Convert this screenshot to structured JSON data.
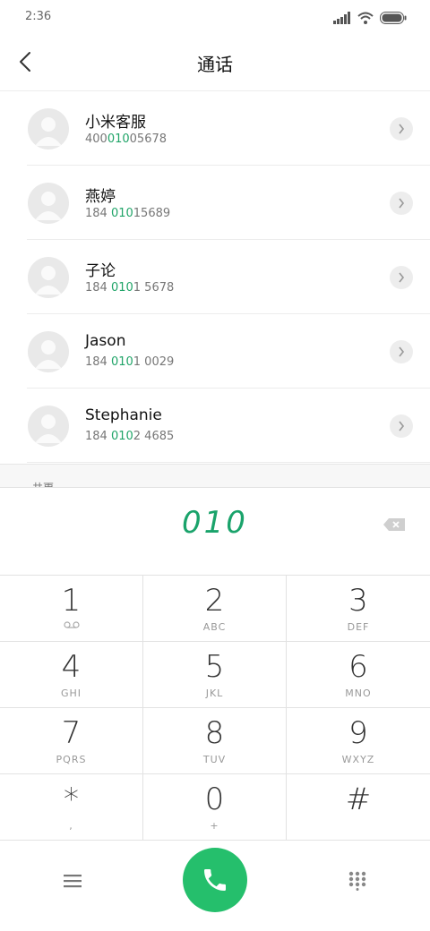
{
  "status_bar": {
    "time": "2:36",
    "icons": [
      "signal-icon",
      "wifi-icon",
      "battery-icon"
    ]
  },
  "header": {
    "back_icon": "chevron-left-icon",
    "title": "通话"
  },
  "contacts": [
    {
      "name": "小米客服",
      "number_parts": [
        "400",
        "010",
        "05678"
      ]
    },
    {
      "name": "燕婷",
      "number_parts": [
        "184 ",
        "010",
        "15689"
      ]
    },
    {
      "name": "子论",
      "number_parts": [
        "184 ",
        "010",
        "1 5678"
      ]
    },
    {
      "name": "Jason",
      "number_parts": [
        "184 ",
        "010",
        "1 0029"
      ]
    },
    {
      "name": "Stephanie",
      "number_parts": [
        "184 ",
        "010",
        "2 4685"
      ]
    }
  ],
  "more_label": "共更",
  "dialer": {
    "number": "010",
    "keys": [
      {
        "digit": "1",
        "letters": ""
      },
      {
        "digit": "2",
        "letters": "ABC"
      },
      {
        "digit": "3",
        "letters": "DEF"
      },
      {
        "digit": "4",
        "letters": "GHI"
      },
      {
        "digit": "5",
        "letters": "JKL"
      },
      {
        "digit": "6",
        "letters": "MNO"
      },
      {
        "digit": "7",
        "letters": "PQRS"
      },
      {
        "digit": "8",
        "letters": "TUV"
      },
      {
        "digit": "9",
        "letters": "WXYZ"
      },
      {
        "digit": "*",
        "letters": ","
      },
      {
        "digit": "0",
        "letters": "+"
      },
      {
        "digit": "#",
        "letters": ""
      }
    ]
  },
  "colors": {
    "accent": "#1aa36b",
    "call_button": "#25bf6c"
  }
}
